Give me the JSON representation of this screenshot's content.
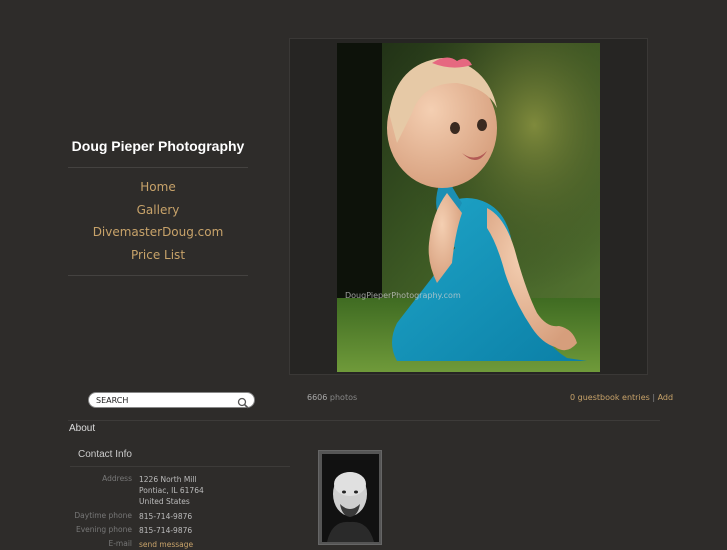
{
  "site": {
    "title": "Doug Pieper Photography"
  },
  "nav": {
    "items": [
      "Home",
      "Gallery",
      "DivemasterDoug.com",
      "Price List"
    ]
  },
  "featured": {
    "watermark": "DougPieperPhotography.com"
  },
  "search": {
    "placeholder": "SEARCH"
  },
  "stats": {
    "photo_count": "6606",
    "photo_label": "photos"
  },
  "guestbook": {
    "entries_label": "0 guestbook entries",
    "separator": "|",
    "add_label": "Add"
  },
  "about": {
    "title": "About",
    "contact_title": "Contact Info",
    "address_label": "Address",
    "address_lines": [
      "1226 North Mill",
      "Pontiac, IL 61764",
      "United States"
    ],
    "daytime_label": "Daytime phone",
    "daytime_value": "815-714-9876",
    "evening_label": "Evening phone",
    "evening_value": "815-714-9876",
    "email_label": "E-mail",
    "email_value": "send message"
  },
  "colors": {
    "background": "#2e2c2a",
    "link": "#c8a36a",
    "title": "#ffffff"
  },
  "icons": {
    "search": "search-icon"
  }
}
